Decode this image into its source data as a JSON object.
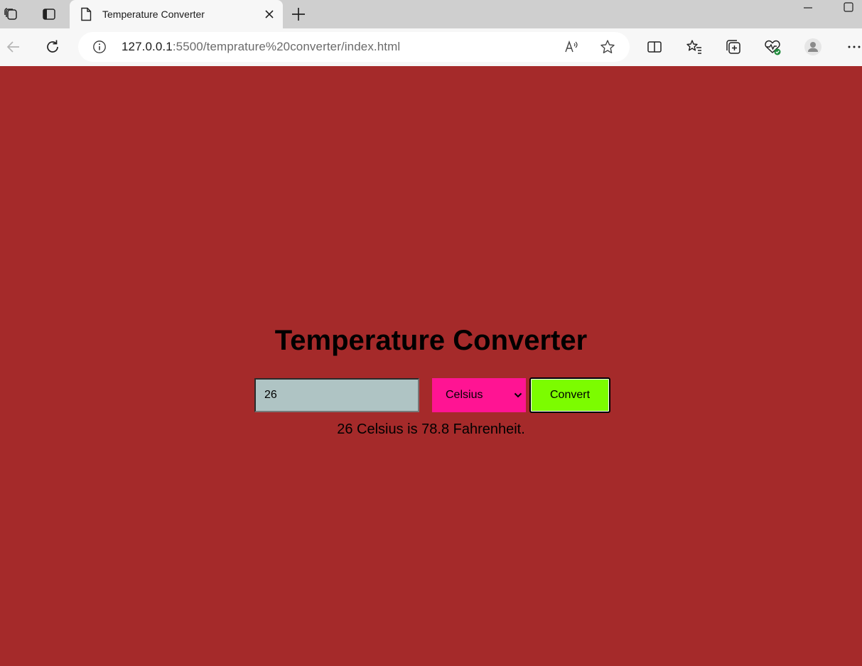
{
  "browser": {
    "tab": {
      "title": "Temperature Converter"
    },
    "address_bar": {
      "url_host": "127.0.0.1",
      "url_rest": ":5500/temprature%20converter/index.html"
    },
    "icons": {
      "workspaces": "workspaces-icon",
      "tab_actions": "tab-actions-icon",
      "page": "page-icon",
      "close_tab": "close-icon",
      "new_tab": "plus-icon",
      "minimize": "minimize-icon",
      "maximize": "maximize-icon",
      "back": "back-arrow-icon",
      "refresh": "refresh-icon",
      "site_info": "info-icon",
      "read_aloud": "read-aloud-icon",
      "favorite": "star-icon",
      "split_screen": "split-screen-icon",
      "favorites": "favorites-icon",
      "collections": "collections-icon",
      "browser_essentials": "heartbeat-icon",
      "profile": "profile-icon",
      "more": "more-icon"
    }
  },
  "page": {
    "heading": "Temperature Converter",
    "temperature_input": {
      "value": "26"
    },
    "unit_select": {
      "selected": "Celsius"
    },
    "convert_button": {
      "label": "Convert"
    },
    "result": "26 Celsius is 78.8 Fahrenheit."
  },
  "colors": {
    "page_background": "#a52a2a",
    "input_background": "#afc4c4",
    "select_background": "#ff1493",
    "button_background": "#7cfc00"
  }
}
